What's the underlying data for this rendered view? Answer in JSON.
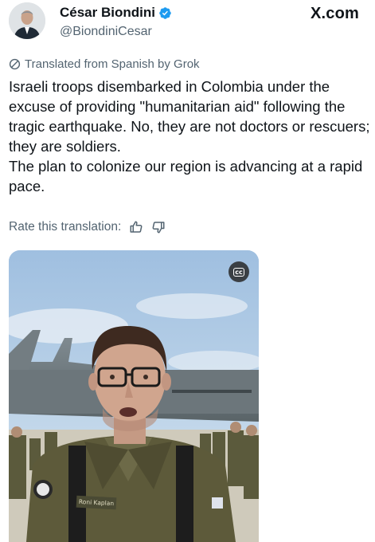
{
  "author": {
    "display_name": "César Biondini",
    "handle": "@BiondiniCesar",
    "verified": true,
    "verified_icon": "verified-badge-icon",
    "verified_color": "#1d9bf0"
  },
  "site_mark": "X.com",
  "translation_note": "Translated from Spanish by Grok",
  "tweet_text": "Israeli troops disembarked in Colombia under the excuse of providing \"humanitarian aid\" following the tragic earthquake. No, they are not doctors or rescuers; they are soldiers.\nThe plan to colonize our region is advancing at a rapid pace.",
  "rate": {
    "label": "Rate this translation:",
    "up_icon": "thumbs-up-icon",
    "down_icon": "thumbs-down-icon"
  },
  "media": {
    "captions_label": "cc",
    "uniform_name_tag": "Roni Kaplan",
    "text_color": "#536471"
  }
}
